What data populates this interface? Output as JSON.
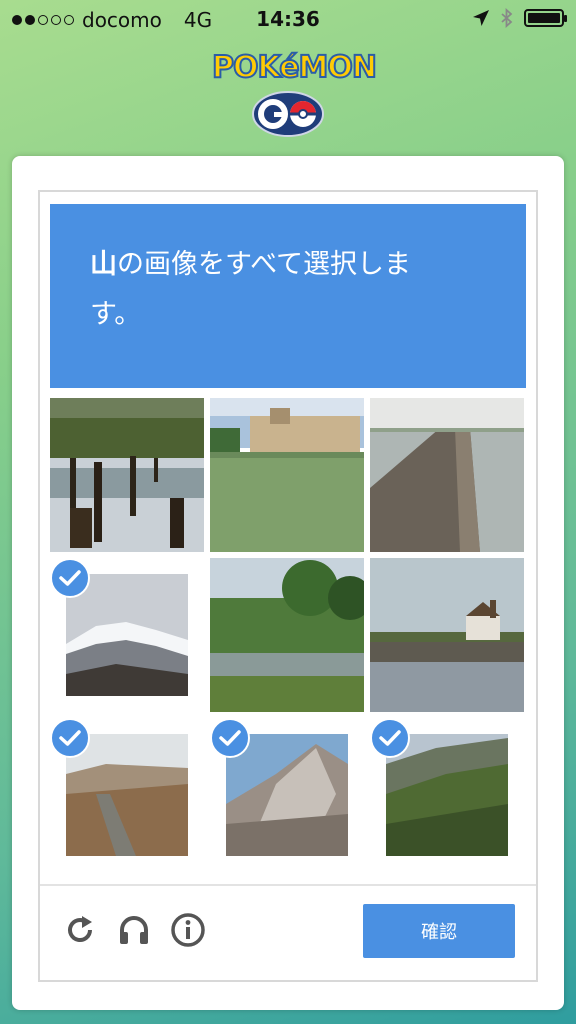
{
  "status_bar": {
    "carrier": "docomo",
    "network": "4G",
    "time": "14:36",
    "signal_dots_filled": 2,
    "signal_dots_total": 5,
    "icons": [
      "location-arrow-icon",
      "bluetooth-icon",
      "battery-icon"
    ],
    "battery_level": 1.0
  },
  "logo": {
    "word": "POKéMON",
    "go": "GO"
  },
  "captcha": {
    "prompt_bold": "山",
    "prompt_rest": "の画像をすべて選択しま",
    "prompt_line2": "す。",
    "tiles": [
      {
        "subject": "swamp with tree stumps",
        "selected": false
      },
      {
        "subject": "palace with lake",
        "selected": false
      },
      {
        "subject": "wooden pier over water",
        "selected": false
      },
      {
        "subject": "snowy mountain",
        "selected": true
      },
      {
        "subject": "river with trees",
        "selected": false
      },
      {
        "subject": "village church by water",
        "selected": false
      },
      {
        "subject": "dry valley with stream",
        "selected": true
      },
      {
        "subject": "rocky mountain peak",
        "selected": true
      },
      {
        "subject": "green hillside",
        "selected": true
      }
    ],
    "footer_icons": [
      "reload-icon",
      "headphones-icon",
      "info-icon"
    ],
    "verify_label": "確認",
    "accent_color": "#4a90e2"
  }
}
